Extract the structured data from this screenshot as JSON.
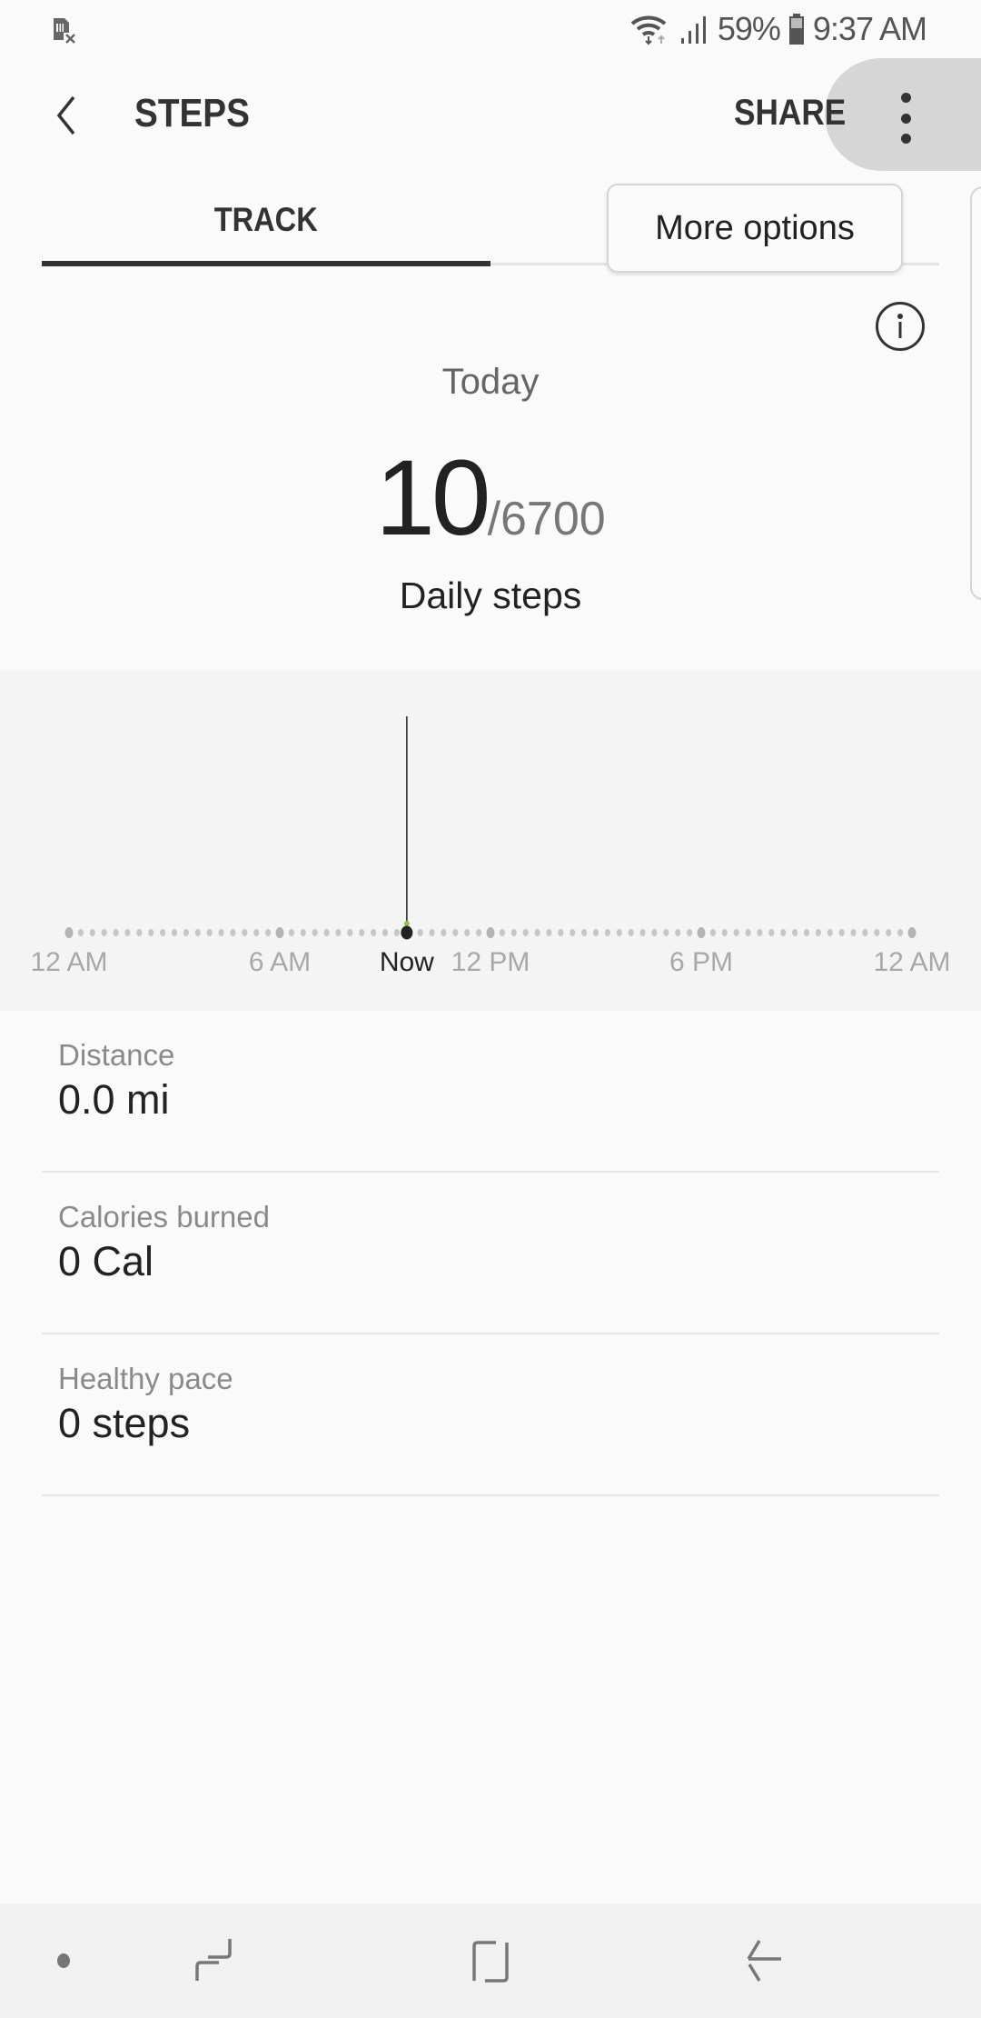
{
  "status_bar": {
    "battery_percent": "59%",
    "time": "9:37 AM",
    "icons": [
      "sim-card-missing-icon",
      "wifi-icon",
      "signal-icon",
      "battery-icon"
    ]
  },
  "app_bar": {
    "title": "STEPS",
    "share_label": "SHARE",
    "back_icon": "chevron-left-icon",
    "more_icon": "more-vertical-icon"
  },
  "tabs": [
    {
      "label": "TRACK",
      "selected": true
    }
  ],
  "tooltip": {
    "text": "More options"
  },
  "summary": {
    "period": "Today",
    "steps": "10",
    "goal": "/6700",
    "label": "Daily steps",
    "info_icon": "info-icon"
  },
  "chart_data": {
    "type": "line",
    "title": "",
    "xlabel": "",
    "ylabel": "",
    "x_range_hours": [
      0,
      24
    ],
    "tick_labels": [
      {
        "label": "12 AM",
        "hour": 0
      },
      {
        "label": "6 AM",
        "hour": 6
      },
      {
        "label": "Now",
        "hour": 9.617
      },
      {
        "label": "12 PM",
        "hour": 12
      },
      {
        "label": "6 PM",
        "hour": 18
      },
      {
        "label": "12 AM",
        "hour": 24
      }
    ],
    "now_hour": 9.617,
    "series": [
      {
        "name": "Steps",
        "points": [
          {
            "hour": 9.617,
            "steps": 10
          }
        ]
      }
    ],
    "dot_interval_minutes": 20,
    "colors": {
      "dot": "#bdbdbd",
      "now_dot": "#222222",
      "now_line": "#333333",
      "accent": "#8bc34a"
    }
  },
  "stats": [
    {
      "label": "Distance",
      "value": "0.0 mi"
    },
    {
      "label": "Calories burned",
      "value": "0 Cal"
    },
    {
      "label": "Healthy pace",
      "value": "0 steps"
    }
  ],
  "nav_bar": {
    "items": [
      "dot-indicator-icon",
      "recent-apps-icon",
      "home-icon",
      "back-icon"
    ]
  }
}
